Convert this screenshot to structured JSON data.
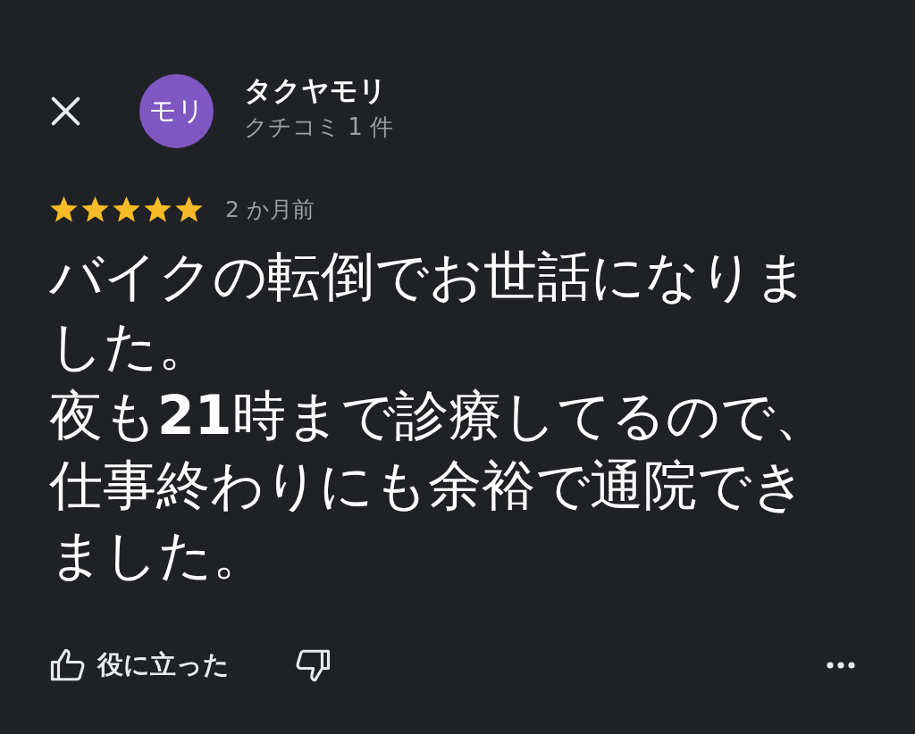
{
  "header": {
    "avatar_initials": "モリ",
    "reviewer_name": "タクヤモリ",
    "review_count": "クチコミ 1 件"
  },
  "review": {
    "stars": 5,
    "age": "2 か月前",
    "paragraphs": [
      "バイクの転倒でお世話になりました。",
      "夜も**21**時まで診療してるので、",
      "仕事終わりにも余裕で通院できました。"
    ]
  },
  "actions": {
    "helpful_label": "役に立った"
  }
}
